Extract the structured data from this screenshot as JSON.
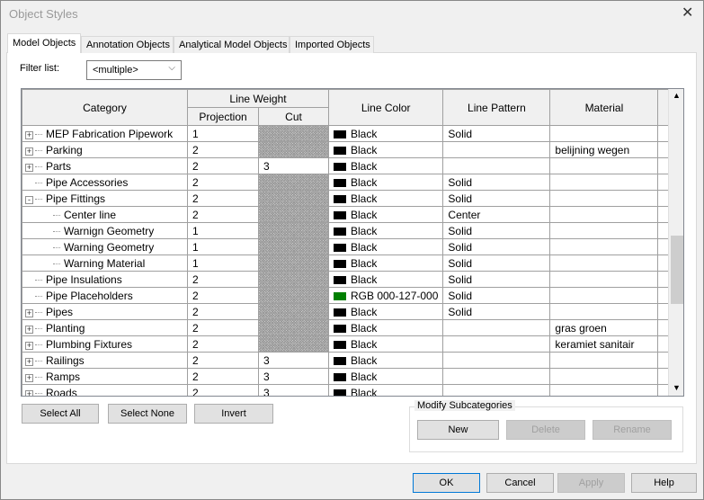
{
  "window": {
    "title": "Object Styles"
  },
  "tabs": [
    "Model Objects",
    "Annotation Objects",
    "Analytical Model Objects",
    "Imported Objects"
  ],
  "filter": {
    "label": "Filter list:",
    "value": "<multiple>"
  },
  "table": {
    "headers": {
      "category": "Category",
      "line_weight": "Line Weight",
      "projection": "Projection",
      "cut": "Cut",
      "line_color": "Line Color",
      "line_pattern": "Line Pattern",
      "material": "Material"
    },
    "rows": [
      {
        "expander": "+",
        "level": 0,
        "category": "MEP Fabrication Pipework",
        "projection": "1",
        "cut": "",
        "cut_hatched": true,
        "color": "Black",
        "color_hex": "#000000",
        "pattern": "Solid",
        "material": ""
      },
      {
        "expander": "+",
        "level": 0,
        "category": "Parking",
        "projection": "2",
        "cut": "",
        "cut_hatched": true,
        "color": "Black",
        "color_hex": "#000000",
        "pattern": "",
        "material": "belijning wegen"
      },
      {
        "expander": "+",
        "level": 0,
        "category": "Parts",
        "projection": "2",
        "cut": "3",
        "cut_hatched": false,
        "color": "Black",
        "color_hex": "#000000",
        "pattern": "",
        "material": ""
      },
      {
        "expander": "",
        "level": 0,
        "category": "Pipe Accessories",
        "projection": "2",
        "cut": "",
        "cut_hatched": true,
        "color": "Black",
        "color_hex": "#000000",
        "pattern": "Solid",
        "material": ""
      },
      {
        "expander": "-",
        "level": 0,
        "category": "Pipe Fittings",
        "projection": "2",
        "cut": "",
        "cut_hatched": true,
        "color": "Black",
        "color_hex": "#000000",
        "pattern": "Solid",
        "material": ""
      },
      {
        "expander": "",
        "level": 1,
        "category": "Center line",
        "projection": "2",
        "cut": "",
        "cut_hatched": true,
        "color": "Black",
        "color_hex": "#000000",
        "pattern": "Center",
        "material": ""
      },
      {
        "expander": "",
        "level": 1,
        "category": "Warnign Geometry",
        "projection": "1",
        "cut": "",
        "cut_hatched": true,
        "color": "Black",
        "color_hex": "#000000",
        "pattern": "Solid",
        "material": ""
      },
      {
        "expander": "",
        "level": 1,
        "category": "Warning Geometry",
        "projection": "1",
        "cut": "",
        "cut_hatched": true,
        "color": "Black",
        "color_hex": "#000000",
        "pattern": "Solid",
        "material": ""
      },
      {
        "expander": "",
        "level": 1,
        "category": "Warning Material",
        "projection": "1",
        "cut": "",
        "cut_hatched": true,
        "color": "Black",
        "color_hex": "#000000",
        "pattern": "Solid",
        "material": ""
      },
      {
        "expander": "",
        "level": 0,
        "category": "Pipe Insulations",
        "projection": "2",
        "cut": "",
        "cut_hatched": true,
        "color": "Black",
        "color_hex": "#000000",
        "pattern": "Solid",
        "material": ""
      },
      {
        "expander": "",
        "level": 0,
        "category": "Pipe Placeholders",
        "projection": "2",
        "cut": "",
        "cut_hatched": true,
        "color": "RGB 000-127-000",
        "color_hex": "#007f00",
        "pattern": "Solid",
        "material": ""
      },
      {
        "expander": "+",
        "level": 0,
        "category": "Pipes",
        "projection": "2",
        "cut": "",
        "cut_hatched": true,
        "color": "Black",
        "color_hex": "#000000",
        "pattern": "Solid",
        "material": ""
      },
      {
        "expander": "+",
        "level": 0,
        "category": "Planting",
        "projection": "2",
        "cut": "",
        "cut_hatched": true,
        "color": "Black",
        "color_hex": "#000000",
        "pattern": "",
        "material": "gras groen"
      },
      {
        "expander": "+",
        "level": 0,
        "category": "Plumbing Fixtures",
        "projection": "2",
        "cut": "",
        "cut_hatched": true,
        "color": "Black",
        "color_hex": "#000000",
        "pattern": "",
        "material": "keramiet sanitair"
      },
      {
        "expander": "+",
        "level": 0,
        "category": "Railings",
        "projection": "2",
        "cut": "3",
        "cut_hatched": false,
        "color": "Black",
        "color_hex": "#000000",
        "pattern": "",
        "material": ""
      },
      {
        "expander": "+",
        "level": 0,
        "category": "Ramps",
        "projection": "2",
        "cut": "3",
        "cut_hatched": false,
        "color": "Black",
        "color_hex": "#000000",
        "pattern": "",
        "material": ""
      },
      {
        "expander": "+",
        "level": 0,
        "category": "Roads",
        "projection": "2",
        "cut": "3",
        "cut_hatched": false,
        "color": "Black",
        "color_hex": "#000000",
        "pattern": "",
        "material": ""
      }
    ]
  },
  "selection_buttons": {
    "select_all": "Select All",
    "select_none": "Select None",
    "invert": "Invert"
  },
  "modify": {
    "title": "Modify Subcategories",
    "new": "New",
    "delete": "Delete",
    "rename": "Rename"
  },
  "footer": {
    "ok": "OK",
    "cancel": "Cancel",
    "apply": "Apply",
    "help": "Help"
  }
}
